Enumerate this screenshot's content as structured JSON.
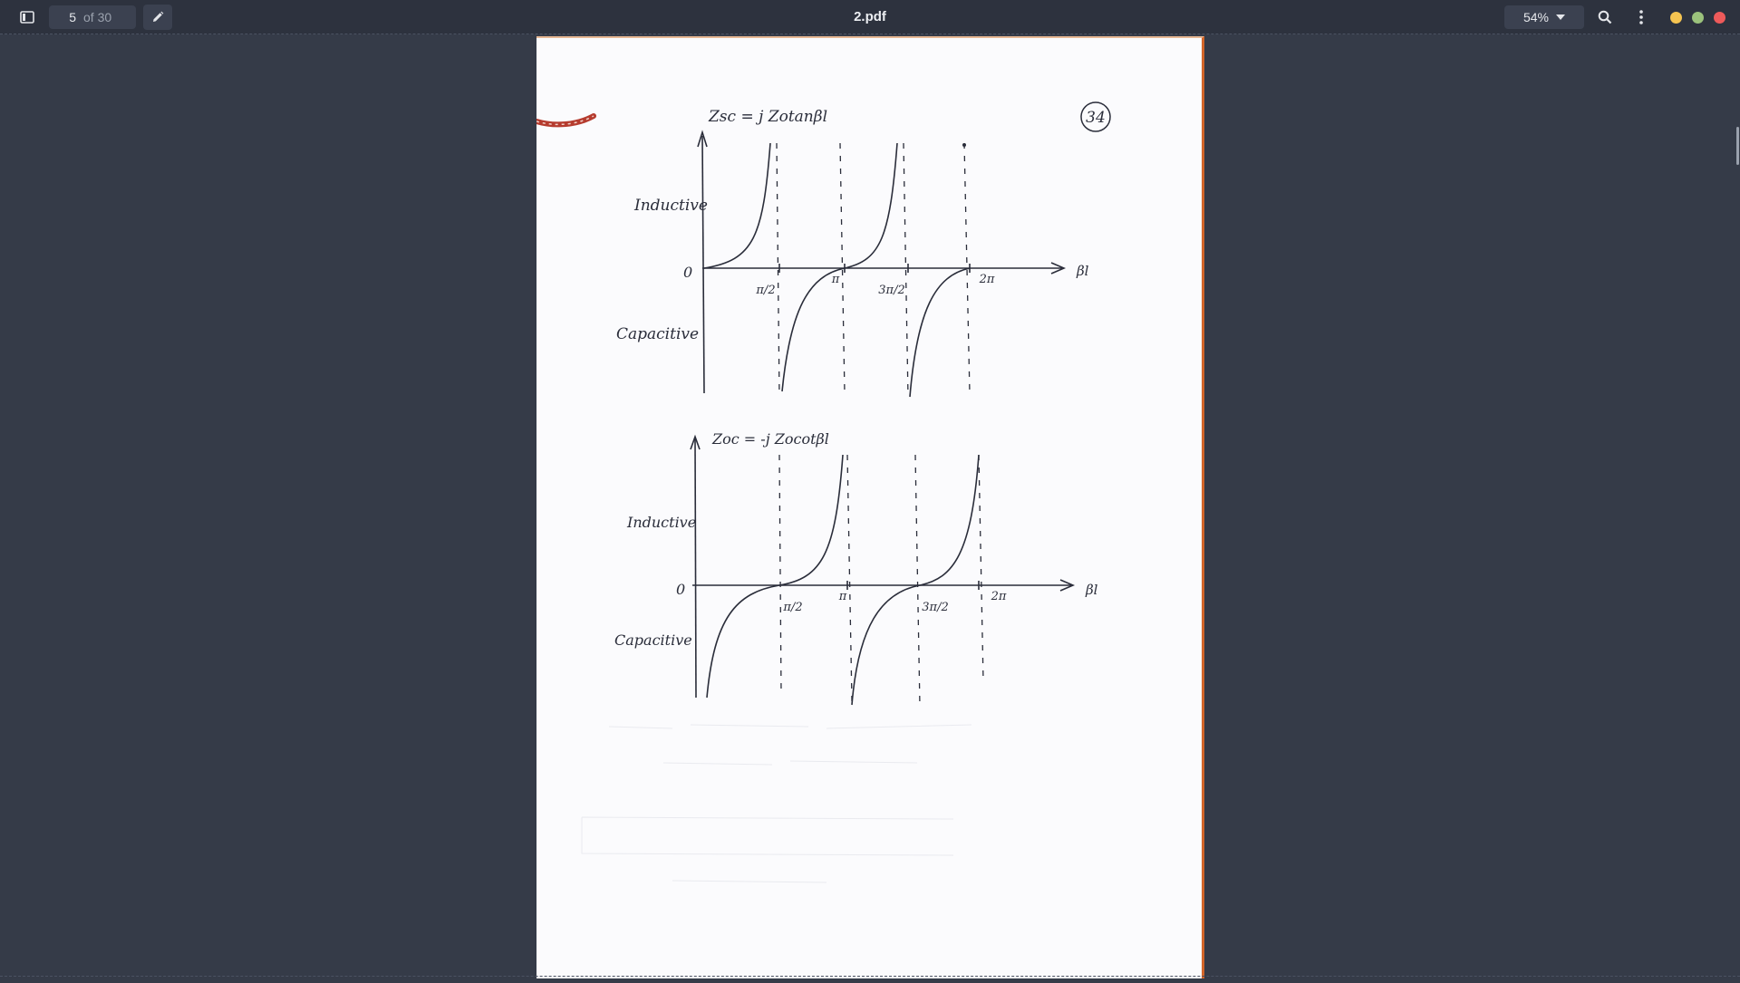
{
  "toolbar": {
    "sidebar_icon": "sidebar-toggle-icon",
    "page_current": "5",
    "page_total_label": "of 30",
    "annotate_icon": "pencil-icon",
    "document_title": "2.pdf",
    "zoom_label": "54%",
    "zoom_icon": "chevron-down-icon",
    "search_icon": "search-icon",
    "menu_icon": "kebab-menu-icon"
  },
  "window_controls": {
    "minimize_color": "#f5c451",
    "maximize_color": "#9bc27c",
    "close_color": "#ee5a5a"
  },
  "page_content": {
    "page_mark": "34",
    "graph1": {
      "title": "Zsc = j Zotanβl",
      "label_inductive": "Inductive",
      "label_capacitive": "Capacitive",
      "origin": "0",
      "x_axis": "βl",
      "ticks": [
        "π/2",
        "π",
        "3π/2",
        "2π"
      ]
    },
    "graph2": {
      "title": "Zoc = -j Zocotβl",
      "label_inductive": "Inductive",
      "label_capacitive": "Capacitive",
      "origin": "0",
      "x_axis": "βl",
      "ticks": [
        "π/2",
        "π",
        "3π/2",
        "2π"
      ]
    }
  }
}
